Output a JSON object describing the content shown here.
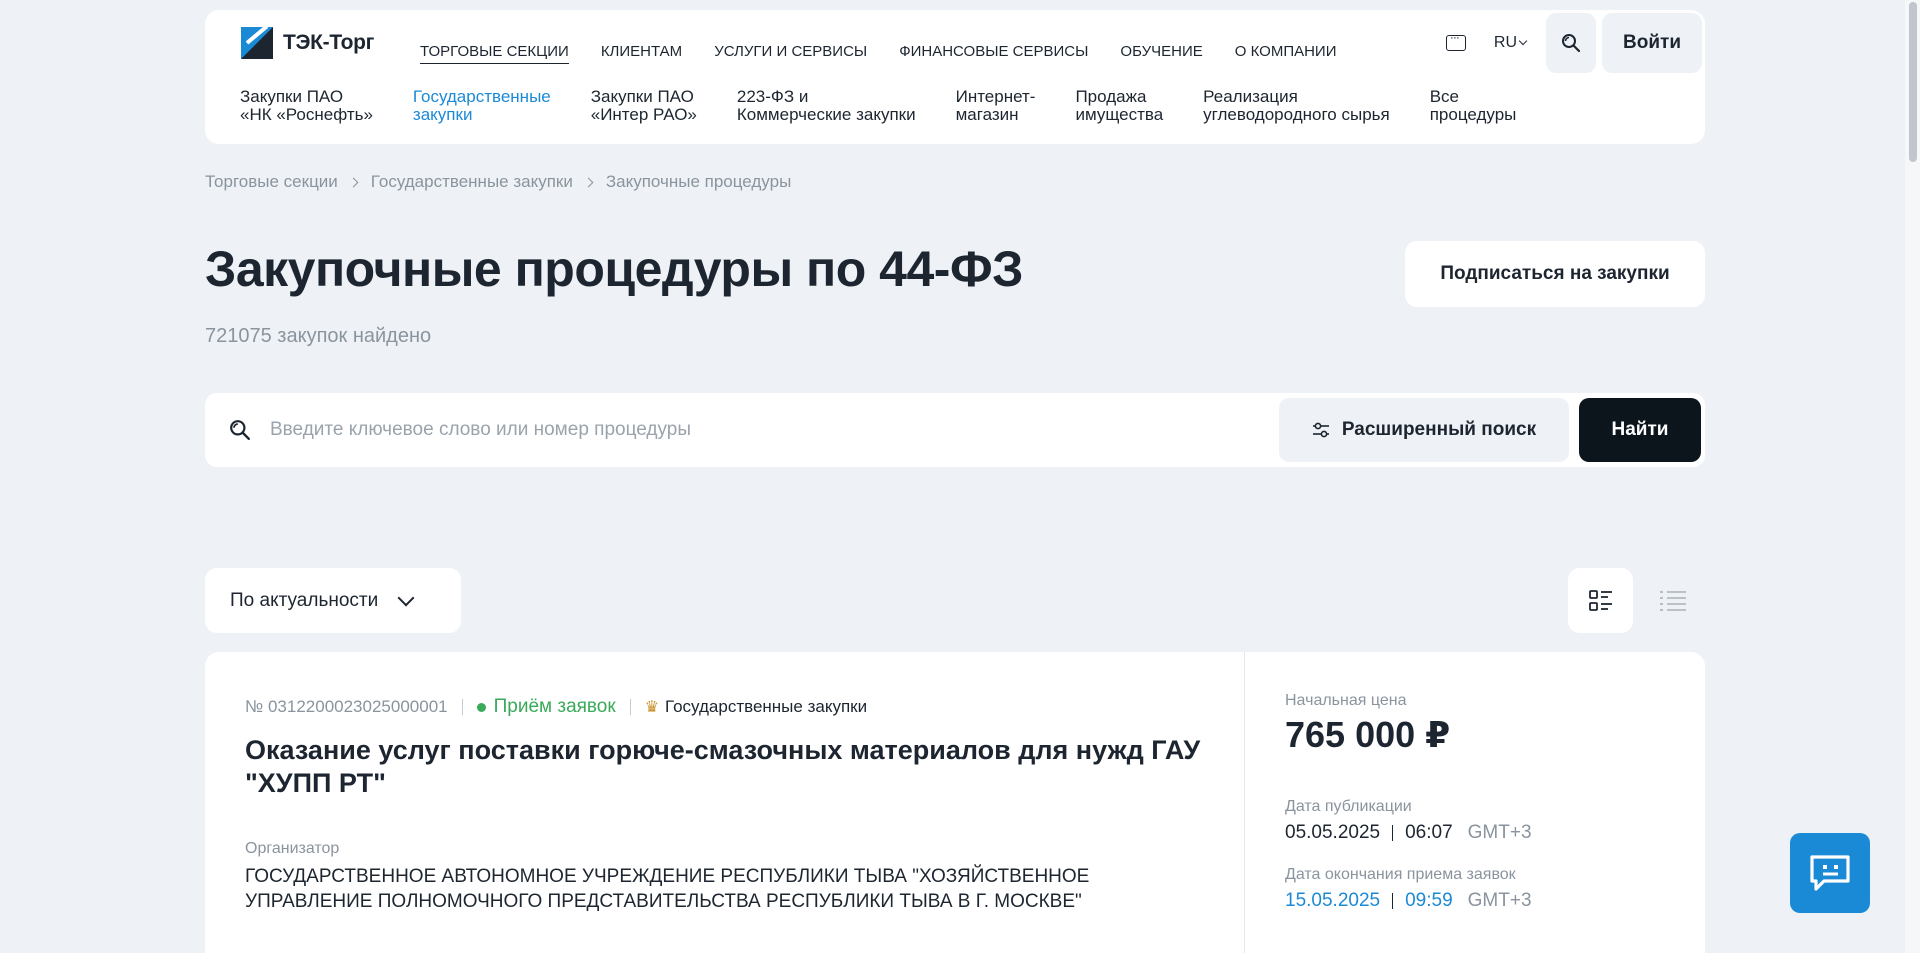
{
  "header": {
    "logo_text": "ТЭК-Торг",
    "topnav": [
      {
        "label": "ТОРГОВЫЕ СЕКЦИИ"
      },
      {
        "label": "КЛИЕНТАМ"
      },
      {
        "label": "УСЛУГИ И СЕРВИСЫ"
      },
      {
        "label": "ФИНАНСОВЫЕ СЕРВИСЫ"
      },
      {
        "label": "ОБУЧЕНИЕ"
      },
      {
        "label": "О КОМПАНИИ"
      }
    ],
    "lang": "RU",
    "login_label": "Войти",
    "subnav": [
      {
        "label": "Закупки ПАО\n«НК «Роснефть»"
      },
      {
        "label": "Государственные\nзакупки"
      },
      {
        "label": "Закупки ПАО\n«Интер РАО»"
      },
      {
        "label": "223-ФЗ и\nКоммерческие закупки"
      },
      {
        "label": "Интернет-\nмагазин"
      },
      {
        "label": "Продажа\nимущества"
      },
      {
        "label": "Реализация\nуглеводородного сырья"
      },
      {
        "label": "Все\nпроцедуры"
      }
    ]
  },
  "breadcrumb": [
    "Торговые секции",
    "Государственные закупки",
    "Закупочные процедуры"
  ],
  "page": {
    "title": "Закупочные процедуры по 44-ФЗ",
    "count": "721075 закупок найдено",
    "subscribe_label": "Подписаться на закупки"
  },
  "search": {
    "placeholder": "Введите ключевое слово или номер процедуры",
    "advanced_label": "Расширенный поиск",
    "find_label": "Найти"
  },
  "sort": {
    "selected": "По актуальности"
  },
  "card": {
    "number": "№ 0312200023025000001",
    "status": "Приём заявок",
    "section": "Государственные закупки",
    "title": "Оказание услуг поставки горюче-смазочных материалов для нужд ГАУ \"ХУПП РТ\"",
    "org_label": "Организатор",
    "org_name": "ГОСУДАРСТВЕННОЕ АВТОНОМНОЕ УЧРЕЖДЕНИЕ РЕСПУБЛИКИ ТЫВА \"ХОЗЯЙСТВЕННОЕ УПРАВЛЕНИЕ ПОЛНОМОЧНОГО ПРЕДСТАВИТЕЛЬСТВА РЕСПУБЛИКИ ТЫВА В Г. МОСКВЕ\"",
    "price_label": "Начальная цена",
    "price": "765 000 ₽",
    "pub_label": "Дата публикации",
    "pub_date": "05.05.2025",
    "pub_time": "06:07",
    "pub_tz": "GMT+3",
    "end_label": "Дата окончания приема заявок",
    "end_date": "15.05.2025",
    "end_time": "09:59",
    "end_tz": "GMT+3"
  },
  "colors": {
    "accent": "#1b8ad6",
    "status_green": "#3aaa5a",
    "dark": "#1d2630",
    "bg": "#eef2f6"
  },
  "icons": [
    "chat-icon",
    "search-icon",
    "filter-icon",
    "chevron-down-icon",
    "view-cards-icon",
    "view-list-icon",
    "support-chat-icon"
  ]
}
